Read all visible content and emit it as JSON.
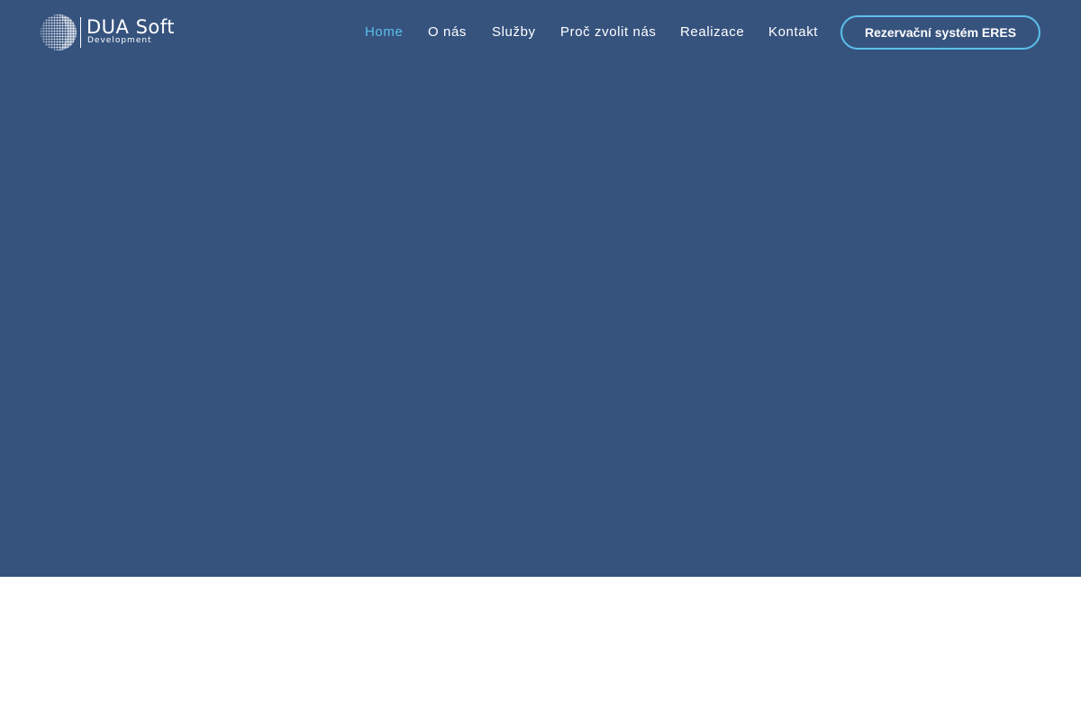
{
  "brand": {
    "name": "DUA Soft",
    "subtitle": "Development",
    "logo_icon": "halftone-sphere-icon"
  },
  "nav": {
    "items": [
      {
        "label": "Home",
        "active": true
      },
      {
        "label": "O nás",
        "active": false
      },
      {
        "label": "Služby",
        "active": false
      },
      {
        "label": "Proč zvolit nás",
        "active": false
      },
      {
        "label": "Realizace",
        "active": false
      },
      {
        "label": "Kontakt",
        "active": false
      }
    ],
    "cta_label": "Rezervační systém ERES"
  },
  "colors": {
    "hero_background": "#36537e",
    "accent": "#5bc0eb",
    "nav_text": "#ffffff",
    "page_background": "#ffffff"
  }
}
